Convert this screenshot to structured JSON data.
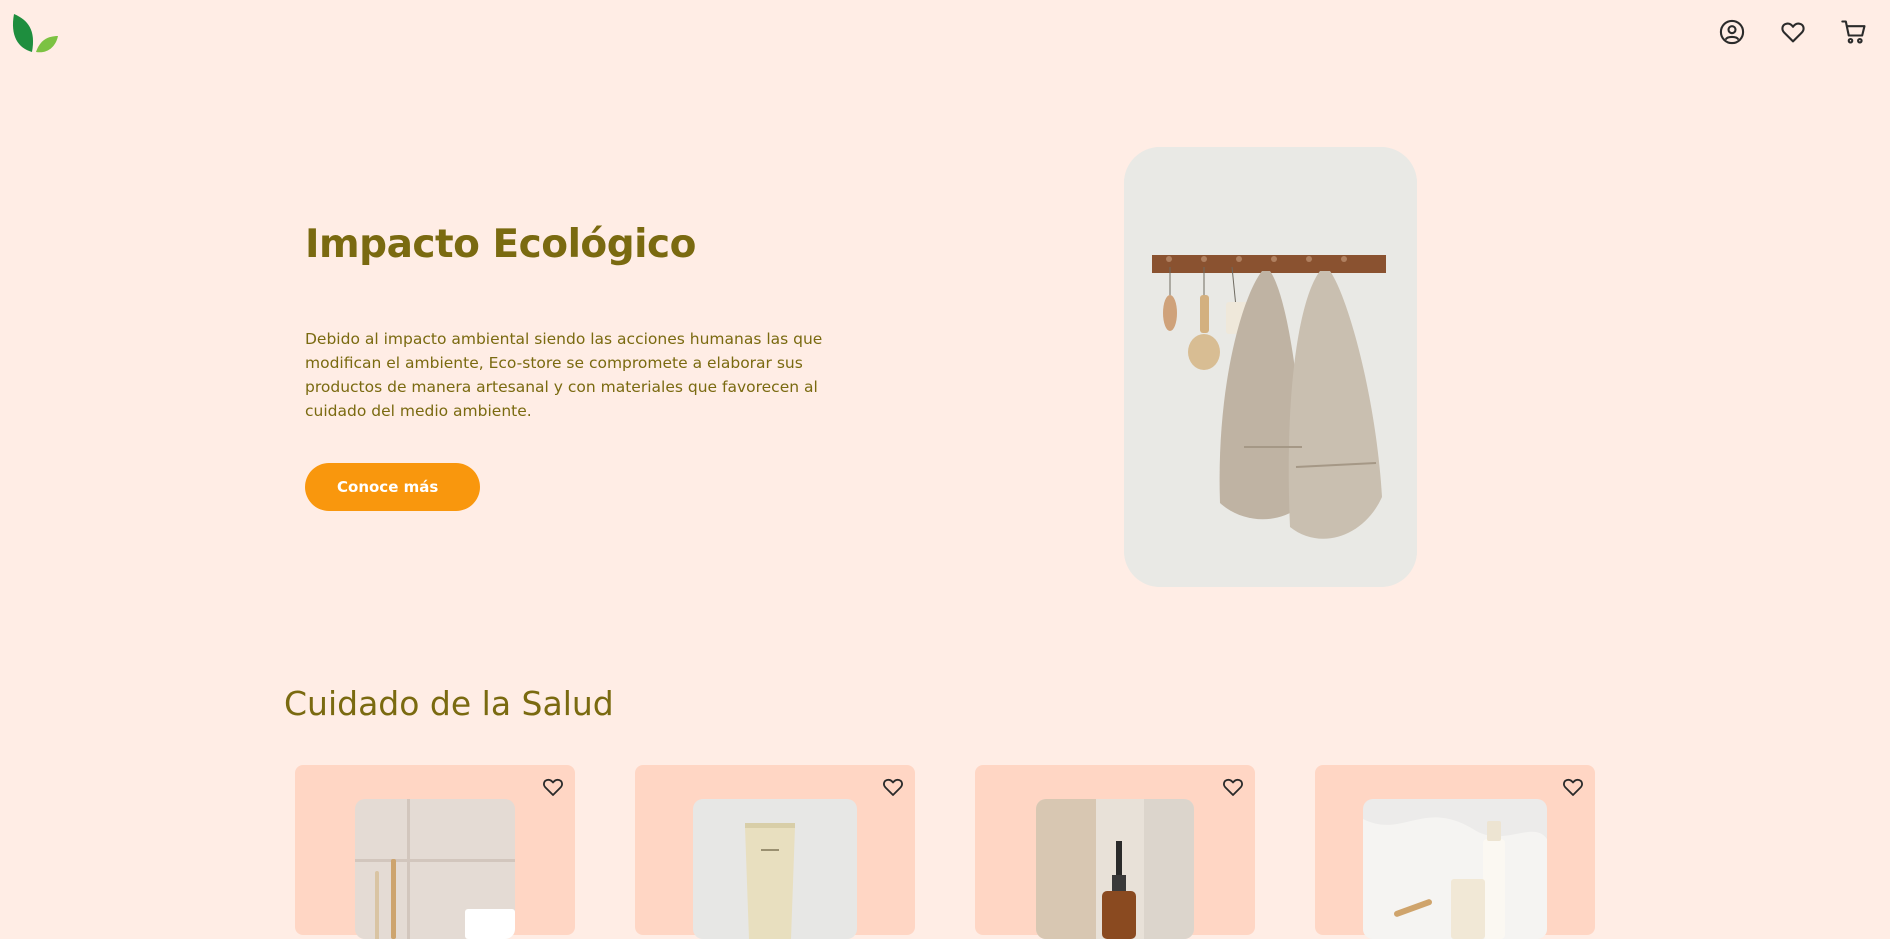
{
  "header": {
    "logo_icon": "leaf-logo-icon",
    "icons": [
      "user-account-icon",
      "heart-icon",
      "shopping-cart-icon"
    ]
  },
  "hero": {
    "title": "Impacto Ecológico",
    "description": "Debido al impacto ambiental siendo las acciones humanas las que modifican el ambiente, Eco-store se compromete a elaborar sus productos de manera artesanal y con materiales que favorecen al cuidado del medio ambiente.",
    "button_label": "Conoce más",
    "image_icon": "towels-on-hooks-photo"
  },
  "section": {
    "title": "Cuidado de la Salud"
  },
  "products": [
    {
      "image": "bamboo-toothbrush-photo",
      "favorite_icon": "heart-icon"
    },
    {
      "image": "cream-tube-photo",
      "favorite_icon": "heart-icon"
    },
    {
      "image": "amber-dropper-bottle-photo",
      "favorite_icon": "heart-icon"
    },
    {
      "image": "skincare-set-photo",
      "favorite_icon": "heart-icon"
    }
  ],
  "colors": {
    "background": "#ffede5",
    "accent": "#f9970d",
    "text": "#7a6a10",
    "card": "#ffd6c4",
    "logo_dark": "#1e8e3e",
    "logo_light": "#7cc242"
  }
}
